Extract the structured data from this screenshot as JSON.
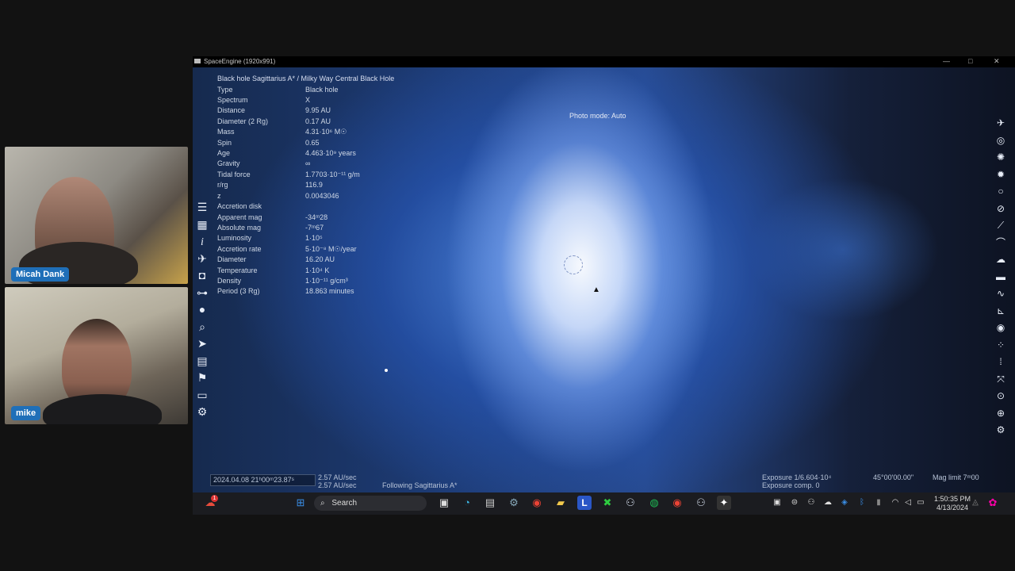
{
  "participants": [
    {
      "name": "Micah Dank"
    },
    {
      "name": "mike"
    }
  ],
  "window": {
    "title": "SpaceEngine (1920x991)",
    "minimize": "—",
    "maximize": "□",
    "close": "✕"
  },
  "object": {
    "heading": "Black hole  Sagittarius A* / Milky Way Central Black Hole",
    "properties": [
      {
        "label": "Type",
        "value": "Black hole"
      },
      {
        "label": "Spectrum",
        "value": "X"
      },
      {
        "label": "Distance",
        "value": "9.95 AU"
      },
      {
        "label": "Diameter (2 Rg)",
        "value": "0.17 AU"
      },
      {
        "label": "Mass",
        "value": "4.31·10⁶ M☉"
      },
      {
        "label": "Spin",
        "value": "0.65"
      },
      {
        "label": "Age",
        "value": "4.463·10⁹ years"
      },
      {
        "label": "Gravity",
        "value": "∞"
      },
      {
        "label": "Tidal force",
        "value": "1.7703·10⁻¹¹ g/m"
      },
      {
        "label": "r/rg",
        "value": "116.9"
      },
      {
        "label": "z",
        "value": "0.0043046"
      }
    ],
    "disk_title": "Accretion disk",
    "disk_properties": [
      {
        "label": "Apparent mag",
        "value": "-34ᵐ28"
      },
      {
        "label": "Absolute mag",
        "value": "-7ᵐ67"
      },
      {
        "label": "Luminosity",
        "value": "1·10⁵"
      },
      {
        "label": "Accretion rate",
        "value": "5·10⁻⁸ M☉/year"
      },
      {
        "label": "Diameter",
        "value": "16.20 AU"
      },
      {
        "label": "Temperature",
        "value": "1·10⁴ K"
      },
      {
        "label": "Density",
        "value": "1·10⁻¹¹ g/cm³"
      },
      {
        "label": "Period (3 Rg)",
        "value": "18.863 minutes"
      }
    ]
  },
  "photo_mode": "Photo mode: Auto",
  "status": {
    "datetime": "2024.04.08 21ʰ00ᵐ23.87ˢ",
    "speed1": "2.57 AU/sec",
    "speed2": "2.57 AU/sec",
    "following": "Following Sagittarius A*",
    "exposure": "Exposure 1/6.604·10⁴",
    "exposure_comp": "Exposure comp. 0",
    "fov": "45°00'00.00\"",
    "mag_limit": "Mag limit 7ᵐ00"
  },
  "taskbar": {
    "search_label": "Search",
    "time": "1:50:35 PM",
    "date": "4/13/2024",
    "notification_count": "1"
  },
  "left_toolbar_icons": [
    "menu-icon",
    "catalog-icon",
    "info-icon",
    "ship-icon",
    "camera-icon",
    "hold-icon",
    "move-icon",
    "search-icon",
    "navigate-icon",
    "calendar-icon",
    "flag-icon",
    "display-icon",
    "settings-icon"
  ],
  "right_toolbar_icons": [
    "ship-icon",
    "galaxy-icon",
    "nebula-icon",
    "star-cluster-icon",
    "planet-icon",
    "orbit-icon",
    "comet-icon",
    "asteroid-icon",
    "cloud-icon",
    "ship-model-icon",
    "water-icon",
    "landscape-icon",
    "eye-icon",
    "stars-icon",
    "scale-icon",
    "fullscreen-icon",
    "target-icon",
    "globe-icon",
    "settings-icon"
  ]
}
